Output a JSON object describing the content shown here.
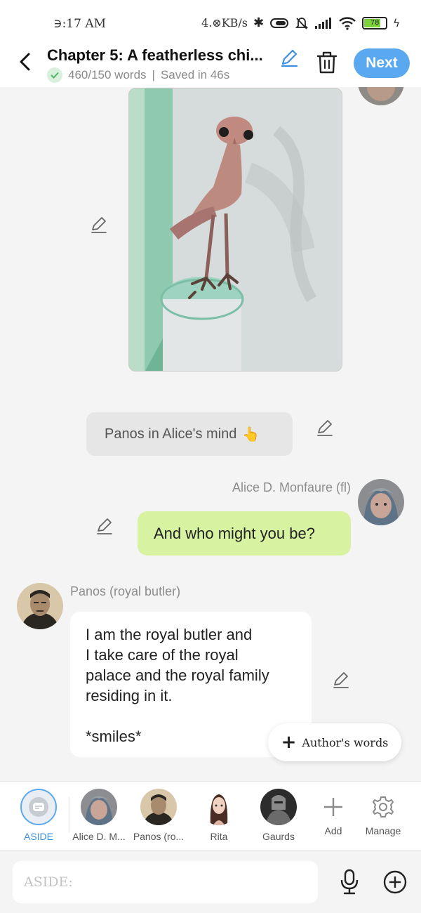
{
  "status_bar": {
    "time": "∋:17 AM",
    "network_speed": "4.⊗KB/s",
    "battery": "78"
  },
  "header": {
    "back_icon": "chevron-left-icon",
    "title": "Chapter 5: A featherless chi...",
    "word_count": "460/150 words",
    "separator": "|",
    "saved": "Saved in 46s",
    "next_label": "Next"
  },
  "messages": {
    "aside_text": "Panos in Alice's mind",
    "aside_emoji": "👆",
    "alice_name": "Alice D. Monfaure (fl)",
    "alice_text": "And who might you be?",
    "panos_name": "Panos (royal butler)",
    "panos_text": "I am the royal butler and\nI take care of the royal\npalace and the royal family\nresiding in it.\n\n*smiles*"
  },
  "authors_words": {
    "label": "Author's words"
  },
  "characters": [
    {
      "label": "ASIDE"
    },
    {
      "label": "Alice D. M..."
    },
    {
      "label": "Panos (ro..."
    },
    {
      "label": "Rita"
    },
    {
      "label": "Gaurds"
    },
    {
      "label": "Add"
    },
    {
      "label": "Manage"
    }
  ],
  "input": {
    "placeholder": "ASIDE:"
  },
  "colors": {
    "accent": "#5aa9f0",
    "user_bubble": "#d7f2a0",
    "aside_bubble": "#e6e6e6",
    "active_label": "#3d8fe0"
  }
}
